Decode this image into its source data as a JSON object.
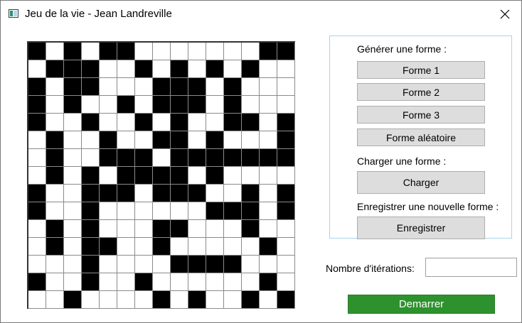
{
  "window": {
    "title": "Jeu de la vie - Jean Landreville",
    "icon": "app-icon",
    "close_icon": "close-icon"
  },
  "grid": {
    "rows": [
      [
        1,
        0,
        1,
        0,
        1,
        1,
        0,
        0,
        0,
        0,
        0,
        0,
        0,
        1,
        1
      ],
      [
        0,
        1,
        1,
        1,
        0,
        0,
        1,
        0,
        1,
        0,
        1,
        0,
        1,
        0,
        0
      ],
      [
        1,
        0,
        1,
        1,
        0,
        0,
        0,
        1,
        1,
        1,
        0,
        1,
        0,
        0,
        0
      ],
      [
        1,
        0,
        1,
        0,
        0,
        1,
        0,
        1,
        1,
        1,
        0,
        1,
        0,
        0,
        0
      ],
      [
        1,
        0,
        0,
        1,
        0,
        0,
        1,
        0,
        1,
        0,
        0,
        1,
        1,
        0,
        1
      ],
      [
        0,
        1,
        0,
        0,
        1,
        0,
        0,
        1,
        1,
        0,
        1,
        0,
        0,
        0,
        1
      ],
      [
        0,
        1,
        0,
        0,
        1,
        1,
        1,
        0,
        1,
        1,
        1,
        1,
        1,
        1,
        1
      ],
      [
        0,
        1,
        0,
        1,
        0,
        1,
        1,
        1,
        1,
        0,
        1,
        0,
        0,
        0,
        0
      ],
      [
        1,
        0,
        0,
        1,
        1,
        1,
        0,
        1,
        1,
        1,
        0,
        0,
        1,
        0,
        1
      ],
      [
        1,
        0,
        0,
        1,
        0,
        0,
        0,
        0,
        0,
        0,
        1,
        1,
        1,
        0,
        1
      ],
      [
        0,
        1,
        0,
        1,
        0,
        0,
        0,
        1,
        1,
        0,
        0,
        0,
        1,
        0,
        0
      ],
      [
        0,
        1,
        0,
        1,
        1,
        0,
        0,
        1,
        0,
        0,
        0,
        0,
        0,
        1,
        0
      ],
      [
        0,
        0,
        0,
        1,
        0,
        0,
        0,
        0,
        1,
        1,
        1,
        1,
        0,
        0,
        0
      ],
      [
        1,
        0,
        0,
        1,
        0,
        0,
        1,
        0,
        0,
        0,
        0,
        0,
        0,
        1,
        0
      ],
      [
        0,
        0,
        1,
        0,
        0,
        0,
        0,
        1,
        0,
        1,
        0,
        0,
        1,
        0,
        1
      ]
    ]
  },
  "panel": {
    "generate_label": "Générer une forme :",
    "shape1_label": "Forme 1",
    "shape2_label": "Forme 2",
    "shape3_label": "Forme 3",
    "random_label": "Forme aléatoire",
    "load_label": "Charger une forme :",
    "load_button": "Charger",
    "save_label": "Enregistrer une nouvelle forme :",
    "save_button": "Enregistrer"
  },
  "iterations": {
    "label": "Nombre d'itérations:",
    "value": ""
  },
  "start_button": "Demarrer",
  "colors": {
    "start_button": "#2d922d",
    "panel_border": "#a9d3ea"
  }
}
